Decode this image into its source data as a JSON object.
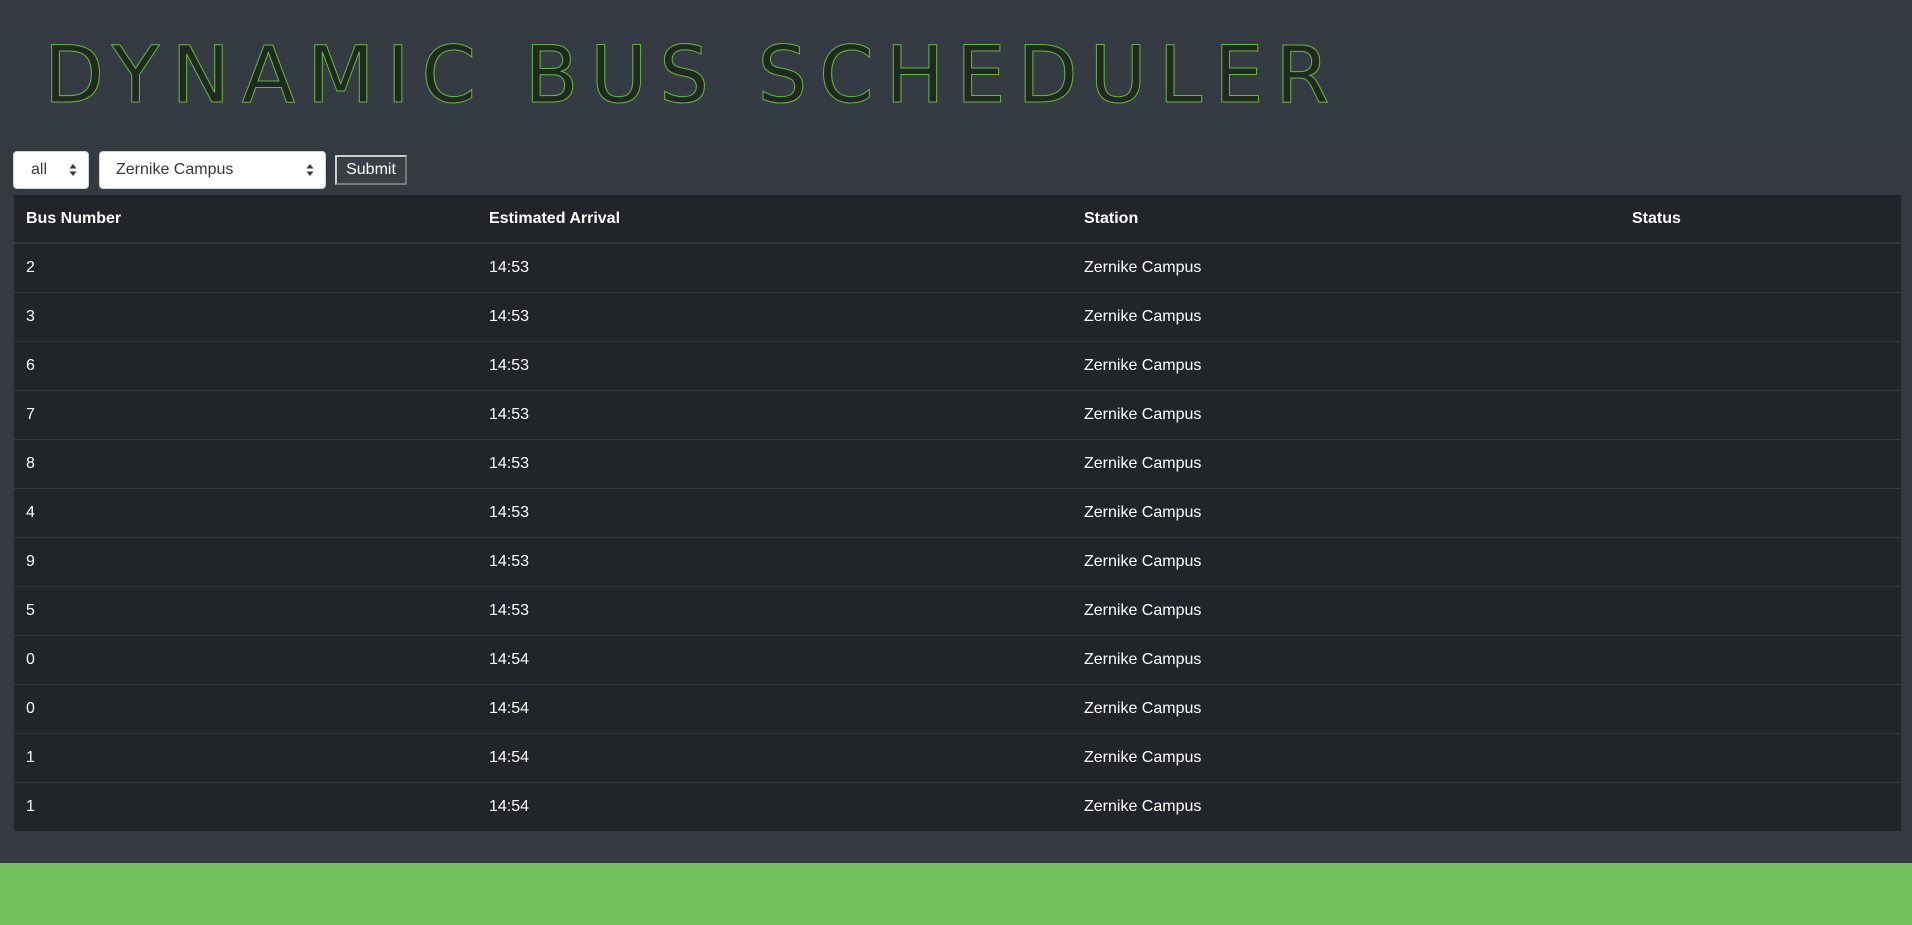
{
  "header": {
    "title": "DYNAMIC BUS SCHEDULER"
  },
  "controls": {
    "route_select_value": "all",
    "station_select_value": "Zernike Campus",
    "submit_label": "Submit"
  },
  "table": {
    "columns": [
      "Bus Number",
      "Estimated Arrival",
      "Station",
      "Status"
    ],
    "rows": [
      {
        "bus": "2",
        "arrival": "14:53",
        "station": "Zernike Campus",
        "status": ""
      },
      {
        "bus": "3",
        "arrival": "14:53",
        "station": "Zernike Campus",
        "status": ""
      },
      {
        "bus": "6",
        "arrival": "14:53",
        "station": "Zernike Campus",
        "status": ""
      },
      {
        "bus": "7",
        "arrival": "14:53",
        "station": "Zernike Campus",
        "status": ""
      },
      {
        "bus": "8",
        "arrival": "14:53",
        "station": "Zernike Campus",
        "status": ""
      },
      {
        "bus": "4",
        "arrival": "14:53",
        "station": "Zernike Campus",
        "status": ""
      },
      {
        "bus": "9",
        "arrival": "14:53",
        "station": "Zernike Campus",
        "status": ""
      },
      {
        "bus": "5",
        "arrival": "14:53",
        "station": "Zernike Campus",
        "status": ""
      },
      {
        "bus": "0",
        "arrival": "14:54",
        "station": "Zernike Campus",
        "status": ""
      },
      {
        "bus": "0",
        "arrival": "14:54",
        "station": "Zernike Campus",
        "status": ""
      },
      {
        "bus": "1",
        "arrival": "14:54",
        "station": "Zernike Campus",
        "status": ""
      },
      {
        "bus": "1",
        "arrival": "14:54",
        "station": "Zernike Campus",
        "status": ""
      }
    ]
  },
  "colors": {
    "page_background": "#343a40",
    "table_background": "#212529",
    "title_accent": "#6ab04c",
    "footer_bar": "#72bf5e"
  },
  "icons": {
    "select_arrows": "sort-arrows-icon"
  }
}
